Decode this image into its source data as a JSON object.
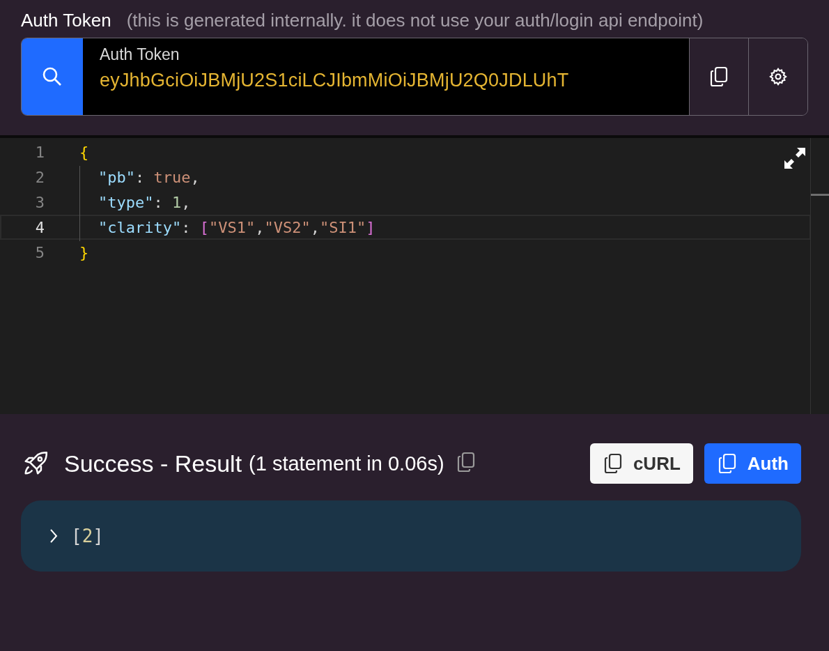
{
  "auth_token": {
    "label": "Auth Token",
    "note": "(this is generated internally. it does not use your auth/login api endpoint)",
    "field_label": "Auth Token",
    "value": "eyJhbGciOiJBMjU2S1ciLCJIbmMiOiJBMjU2Q0JDLUhT"
  },
  "editor": {
    "lines": [
      {
        "number": "1",
        "current": false,
        "indented": false,
        "tokens": [
          {
            "kind": "brace",
            "text": "{"
          }
        ]
      },
      {
        "number": "2",
        "current": false,
        "indented": true,
        "tokens": [
          {
            "kind": "key",
            "text": "\"pb\""
          },
          {
            "kind": "punct",
            "text": ": "
          },
          {
            "kind": "literal",
            "text": "true"
          },
          {
            "kind": "punct",
            "text": ","
          }
        ]
      },
      {
        "number": "3",
        "current": false,
        "indented": true,
        "tokens": [
          {
            "kind": "key",
            "text": "\"type\""
          },
          {
            "kind": "punct",
            "text": ": "
          },
          {
            "kind": "number",
            "text": "1"
          },
          {
            "kind": "punct",
            "text": ","
          }
        ]
      },
      {
        "number": "4",
        "current": true,
        "indented": true,
        "tokens": [
          {
            "kind": "key",
            "text": "\"clarity\""
          },
          {
            "kind": "punct",
            "text": ": "
          },
          {
            "kind": "bracket",
            "text": "["
          },
          {
            "kind": "string",
            "text": "\"VS1\""
          },
          {
            "kind": "punct",
            "text": ","
          },
          {
            "kind": "string",
            "text": "\"VS2\""
          },
          {
            "kind": "punct",
            "text": ","
          },
          {
            "kind": "string",
            "text": "\"SI1\""
          },
          {
            "kind": "bracket",
            "text": "]"
          }
        ]
      },
      {
        "number": "5",
        "current": false,
        "indented": false,
        "tokens": [
          {
            "kind": "brace",
            "text": "}"
          }
        ]
      }
    ]
  },
  "result": {
    "title": "Success - Result",
    "detail": "(1 statement in 0.06s)",
    "buttons": [
      {
        "label": "cURL",
        "kind": "secondary"
      },
      {
        "label": "Auth",
        "kind": "primary"
      }
    ],
    "output": {
      "expanded": false,
      "tokens": [
        {
          "kind": "punct",
          "text": "["
        },
        {
          "kind": "number",
          "text": "2"
        },
        {
          "kind": "punct",
          "text": "]"
        }
      ]
    }
  }
}
